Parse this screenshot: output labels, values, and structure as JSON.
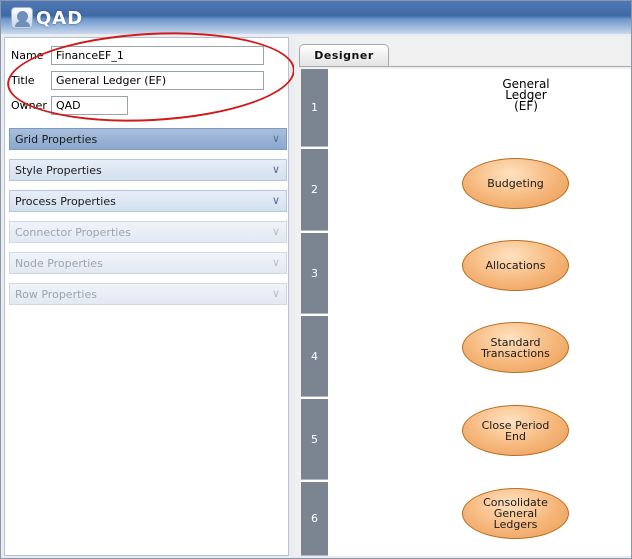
{
  "app": {
    "logo_text": "QAD"
  },
  "form": {
    "name_label": "Name",
    "name_value": "FinanceEF_1",
    "title_label": "Title",
    "title_value": "General Ledger (EF)",
    "owner_label": "Owner",
    "owner_value": "QAD"
  },
  "properties": [
    {
      "label": "Grid Properties",
      "state": "active"
    },
    {
      "label": "Style Properties",
      "state": "enabled"
    },
    {
      "label": "Process Properties",
      "state": "enabled"
    },
    {
      "label": "Connector Properties",
      "state": "disabled"
    },
    {
      "label": "Node Properties",
      "state": "disabled"
    },
    {
      "label": "Row Properties",
      "state": "disabled"
    }
  ],
  "designer": {
    "tab_label": "Designer",
    "title_line1": "General",
    "title_line2": "Ledger",
    "title_line3": "(EF)",
    "rows": [
      "1",
      "2",
      "3",
      "4",
      "5",
      "6"
    ],
    "nodes": [
      {
        "line1": "Budgeting",
        "line2": "",
        "line3": ""
      },
      {
        "line1": "Allocations",
        "line2": "",
        "line3": ""
      },
      {
        "line1": "Standard",
        "line2": "Transactions",
        "line3": ""
      },
      {
        "line1": "Close Period",
        "line2": "End",
        "line3": ""
      },
      {
        "line1": "Consolidate",
        "line2": "General",
        "line3": "Ledgers"
      }
    ]
  },
  "colors": {
    "annotation_circle": "#d11b1b",
    "node_fill": "#f6b67a",
    "row_header": "#7b8491"
  }
}
